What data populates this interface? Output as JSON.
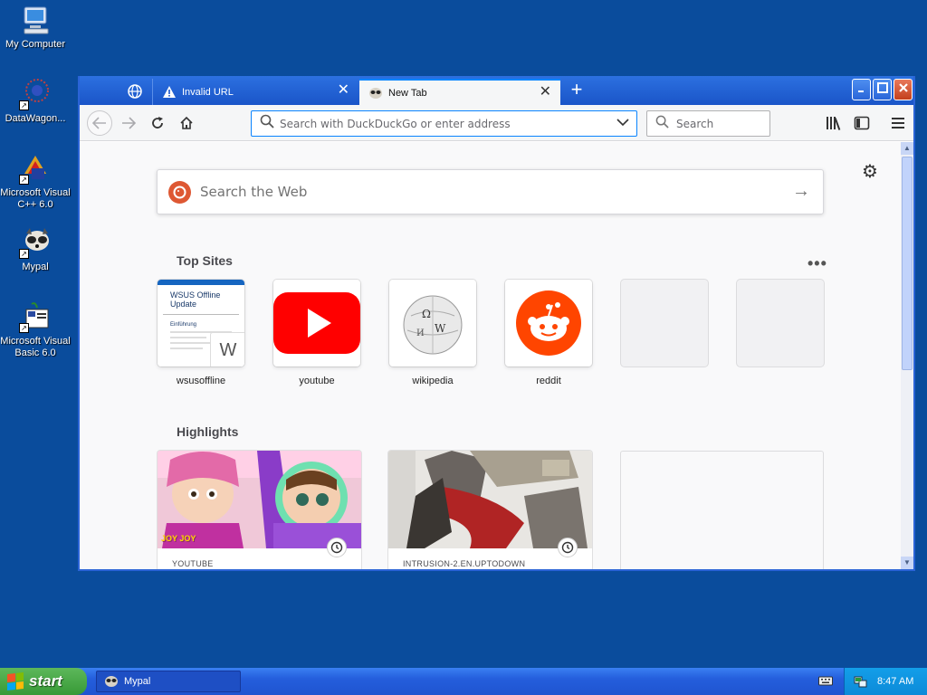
{
  "desktop": {
    "icons": [
      {
        "label": "My Computer"
      },
      {
        "label": "DataWagon..."
      },
      {
        "label": "Microsoft Visual C++ 6.0"
      },
      {
        "label": "Mypal"
      },
      {
        "label": "Microsoft Visual Basic 6.0"
      }
    ]
  },
  "browser": {
    "tabs": [
      {
        "label": "Invalid URL",
        "icon": "warning-icon"
      },
      {
        "label": "New Tab",
        "icon": "mypal-icon",
        "active": true
      }
    ],
    "urlbar": {
      "placeholder": "Search with DuckDuckGo or enter address",
      "value": ""
    },
    "searchbar": {
      "placeholder": "Search"
    },
    "websearch": {
      "placeholder": "Search the Web"
    },
    "top_sites": {
      "title": "Top Sites",
      "tiles": [
        {
          "label": "wsusoffline",
          "thumb_title": "WSUS Offline Update",
          "thumb_sub": "Einführung",
          "letter": "W"
        },
        {
          "label": "youtube"
        },
        {
          "label": "wikipedia"
        },
        {
          "label": "reddit"
        },
        {
          "label": ""
        },
        {
          "label": ""
        }
      ]
    },
    "highlights": {
      "title": "Highlights",
      "cards": [
        {
          "source": "YOUTUBE",
          "thumb_text": "JOY JOY"
        },
        {
          "source": "INTRUSION-2.EN.UPTODOWN"
        }
      ]
    }
  },
  "taskbar": {
    "start_label": "start",
    "items": [
      {
        "label": "Mypal"
      }
    ],
    "clock": "8:47 AM"
  },
  "colors": {
    "desktop": "#0a4c9c",
    "accent": "#0a84ff",
    "youtube": "#ff0000",
    "reddit": "#ff4500",
    "duckduckgo": "#de5833"
  }
}
